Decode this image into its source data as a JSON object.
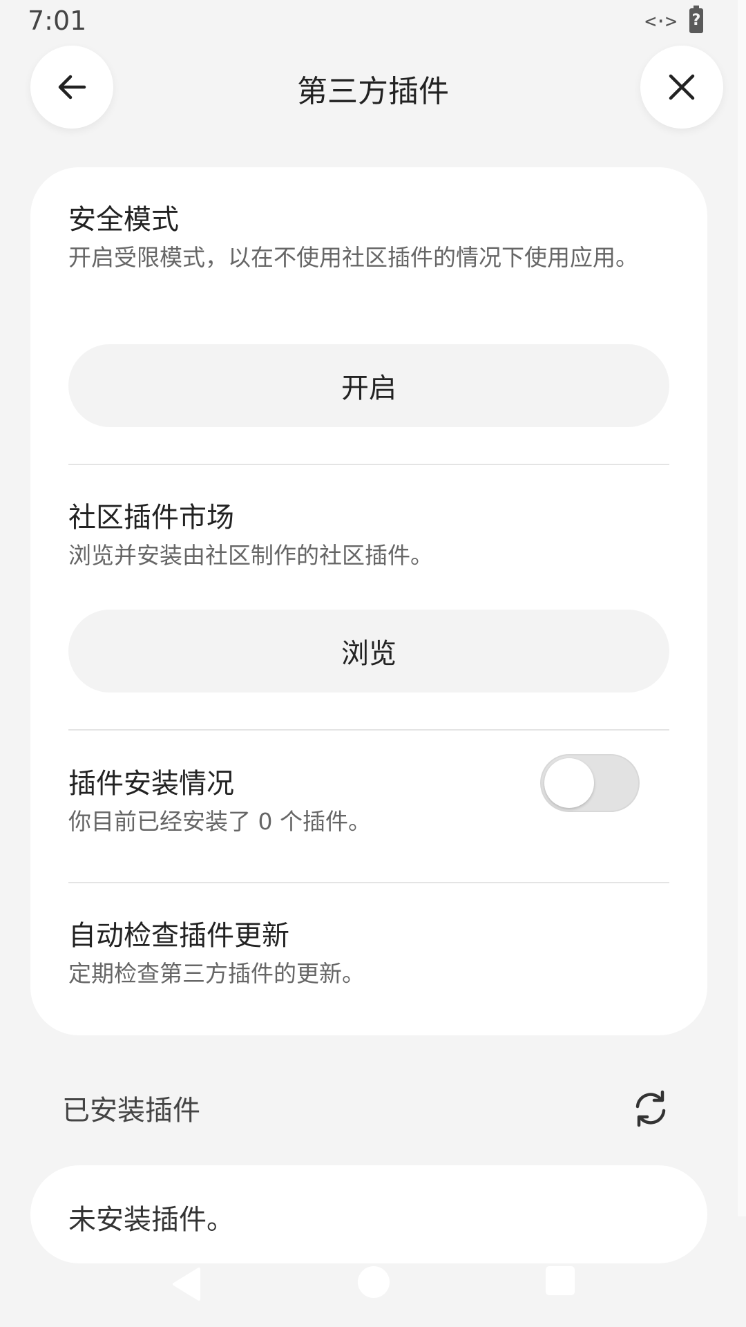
{
  "status_bar": {
    "time": "7:01",
    "code_icon": "<·>",
    "battery_label": "?"
  },
  "header": {
    "title": "第三方插件",
    "back_icon": "arrow-left-icon",
    "close_icon": "close-icon"
  },
  "safe_mode": {
    "title": "安全模式",
    "description": "开启受限模式，以在不使用社区插件的情况下使用应用。",
    "button_label": "开启"
  },
  "marketplace": {
    "title": "社区插件市场",
    "description": "浏览并安装由社区制作的社区插件。",
    "button_label": "浏览"
  },
  "install_status": {
    "title": "插件安装情况",
    "description": "你目前已经安装了 0 个插件。"
  },
  "auto_update": {
    "title": "自动检查插件更新",
    "description": "定期检查第三方插件的更新。",
    "enabled": false
  },
  "installed": {
    "label": "已安装插件",
    "refresh_icon": "refresh-icon",
    "empty_text": "未安装插件。"
  },
  "colors": {
    "background": "#f4f4f4",
    "card": "#ffffff",
    "pill_button": "#f3f3f3"
  }
}
